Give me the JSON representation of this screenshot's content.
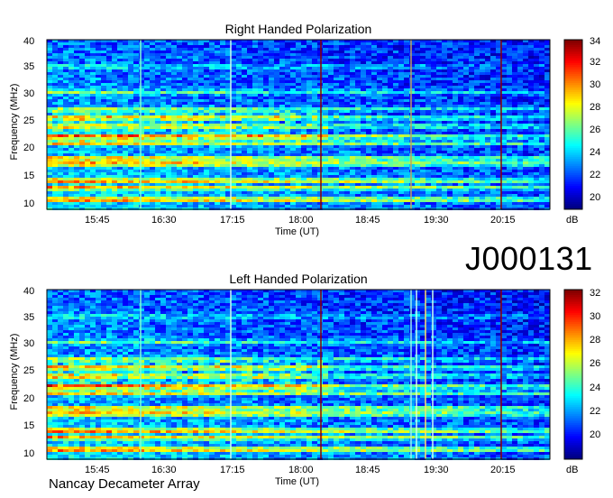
{
  "chart_data": [
    {
      "type": "heatmap",
      "title": "Right Handed Polarization",
      "xlabel": "Time (UT)",
      "ylabel": "Frequency (MHz)",
      "x_ticks": [
        "15:45",
        "16:30",
        "17:15",
        "18:00",
        "18:45",
        "19:30",
        "20:15"
      ],
      "y_ticks": [
        "40",
        "35",
        "30",
        "25",
        "20",
        "15",
        "10"
      ],
      "ylim": [
        10,
        40
      ],
      "colorbar": {
        "unit": "dB",
        "ticks": [
          "34",
          "32",
          "30",
          "28",
          "26",
          "24",
          "22",
          "20"
        ],
        "range": [
          19,
          34
        ]
      }
    },
    {
      "type": "heatmap",
      "title": "Left Handed Polarization",
      "xlabel": "Time (UT)",
      "ylabel": "Frequency (MHz)",
      "x_ticks": [
        "15:45",
        "16:30",
        "17:15",
        "18:00",
        "18:45",
        "19:30",
        "20:15"
      ],
      "y_ticks": [
        "40",
        "35",
        "30",
        "25",
        "20",
        "15",
        "10"
      ],
      "ylim": [
        10,
        40
      ],
      "colorbar": {
        "unit": "dB",
        "ticks": [
          "32",
          "30",
          "28",
          "26",
          "24",
          "22",
          "20"
        ],
        "range": [
          19,
          33.5
        ]
      }
    }
  ],
  "observation_id": "J000131",
  "footer": "Nancay Decameter Array",
  "colors": {
    "low": "#00008f",
    "mid": "#00c8ff",
    "high": "#ffff00",
    "peak": "#8b0000"
  }
}
